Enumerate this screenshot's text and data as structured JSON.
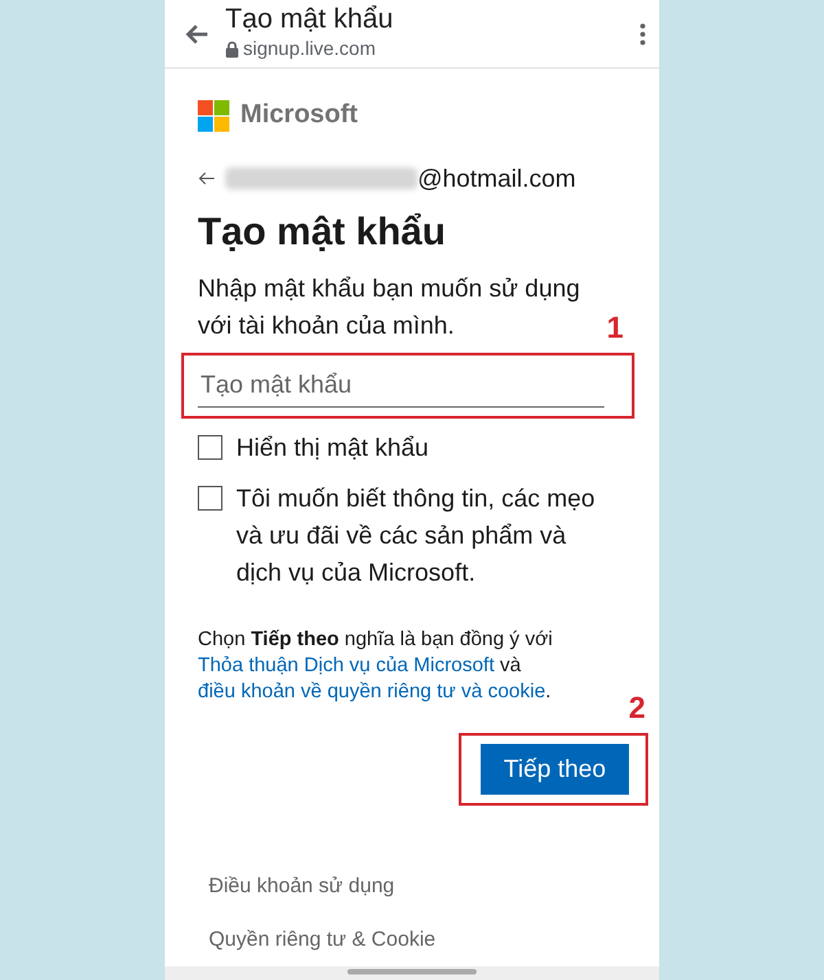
{
  "browser_bar": {
    "title": "Tạo mật khẩu",
    "url": "signup.live.com"
  },
  "brand": "Microsoft",
  "account": {
    "email_suffix": "@hotmail.com"
  },
  "heading": "Tạo mật khẩu",
  "instructions": "Nhập mật khẩu bạn muốn sử dụng với tài khoản của mình.",
  "password_field": {
    "placeholder": "Tạo mật khẩu",
    "annotation": "1"
  },
  "checkboxes": [
    {
      "label": "Hiển thị mật khẩu",
      "checked": false
    },
    {
      "label": "Tôi muốn biết thông tin, các mẹo và ưu đãi về các sản phẩm và dịch vụ của Microsoft.",
      "checked": false
    }
  ],
  "legal": {
    "intro": "Chọn **Tiếp theo** nghĩa là bạn đồng ý với",
    "link_1": "Thỏa thuận Dịch vụ của Microsoft",
    "middle": "và",
    "link_2": "điều khoản về quyền riêng tư và cookie",
    "end": "."
  },
  "next_button": {
    "label": "Tiếp theo",
    "annotation": "2"
  },
  "footer_links": [
    "Điều khoản sử dụng",
    "Quyền riêng tư & Cookie"
  ]
}
